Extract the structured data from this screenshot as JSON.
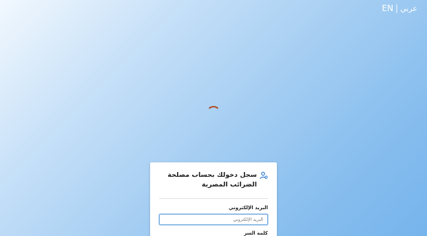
{
  "header": {
    "lang_en": "EN",
    "lang_separator": "|",
    "lang_ar": "عربي"
  },
  "loading": {
    "spinner_color": "#b04a1e"
  },
  "login": {
    "title": "سجل دخولك بحساب مصلحة الضرائب المصرية",
    "title_icon": "user-icon",
    "email_label": "البريد الإلكتروني",
    "email_placeholder": "البريد الإلكتروني",
    "email_value": "",
    "password_label": "كلمة السر"
  },
  "colors": {
    "accent": "#2f7ed8",
    "input_focus_border": "#6fa8e0"
  }
}
